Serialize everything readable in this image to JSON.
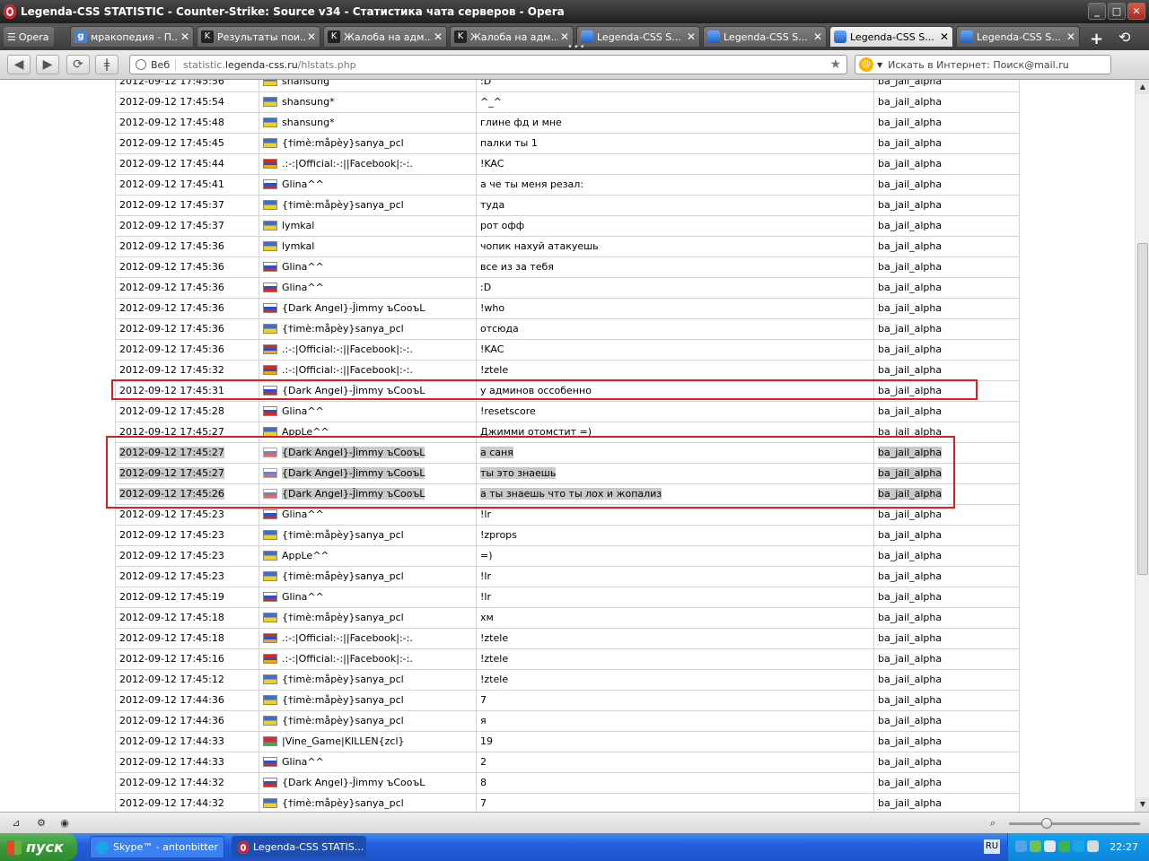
{
  "window": {
    "title": "Legenda-CSS STATISTIC - Counter-Strike: Source v34 - Статистика чата серверов - Opera",
    "minimize": "_",
    "maximize": "□",
    "close": "✕"
  },
  "tabbar": {
    "menu_label": "Opera",
    "tabs": [
      {
        "title": "мракопедия - П...",
        "icon": "google-icon",
        "close": "✕"
      },
      {
        "title": "Результаты пои...",
        "icon": "cs-icon",
        "close": "✕"
      },
      {
        "title": "Жалоба на адм...",
        "icon": "cs-icon",
        "close": "✕"
      },
      {
        "title": "Жалоба на адм...",
        "icon": "cs-icon",
        "close": "✕"
      },
      {
        "title": "Legenda-CSS S...",
        "icon": "site-icon",
        "close": "✕"
      },
      {
        "title": "Legenda-CSS S...",
        "icon": "site-icon",
        "close": "✕"
      },
      {
        "title": "Legenda-CSS S...",
        "icon": "site-icon",
        "close": "✕",
        "active": true
      },
      {
        "title": "Legenda-CSS S...",
        "icon": "site-icon",
        "close": "✕"
      }
    ],
    "dots": "•••",
    "newtab": "+",
    "history": "⟲"
  },
  "addressbar": {
    "web_label": "Веб",
    "url_prefix": "statistic.",
    "url_domain": "legenda-css.ru",
    "url_path": "/hlstats.php",
    "search_placeholder": "Искать в Интернет: Поиск@mail.ru"
  },
  "chat_rows": [
    {
      "time": "2012-09-12 17:45:56",
      "flag": "ua",
      "player": "shansung",
      "message": ":D",
      "map": "ba_jail_alpha"
    },
    {
      "time": "2012-09-12 17:45:54",
      "flag": "ua",
      "player": "shansung*",
      "message": "^_^",
      "map": "ba_jail_alpha"
    },
    {
      "time": "2012-09-12 17:45:48",
      "flag": "ua",
      "player": "shansung*",
      "message": "глине фд и мне",
      "map": "ba_jail_alpha"
    },
    {
      "time": "2012-09-12 17:45:45",
      "flag": "ua",
      "player": "{†imè:måpèy}sanya_pcl",
      "message": "палки ты 1",
      "map": "ba_jail_alpha"
    },
    {
      "time": "2012-09-12 17:45:44",
      "flag": "am",
      "player": ".:-:|Official:-:||Facebook|:-:.",
      "message": "!KAC",
      "map": "ba_jail_alpha"
    },
    {
      "time": "2012-09-12 17:45:41",
      "flag": "ru",
      "player": "Glina^^",
      "message": "а че ты меня резал:",
      "map": "ba_jail_alpha"
    },
    {
      "time": "2012-09-12 17:45:37",
      "flag": "ua",
      "player": "{†imè:måpèy}sanya_pcl",
      "message": "туда",
      "map": "ba_jail_alpha"
    },
    {
      "time": "2012-09-12 17:45:37",
      "flag": "ua",
      "player": "lymkal",
      "message": "рот офф",
      "map": "ba_jail_alpha"
    },
    {
      "time": "2012-09-12 17:45:36",
      "flag": "ua",
      "player": "lymkal",
      "message": "чопик нахуй атакуешь",
      "map": "ba_jail_alpha"
    },
    {
      "time": "2012-09-12 17:45:36",
      "flag": "ru",
      "player": "Glina^^",
      "message": "все из за тебя",
      "map": "ba_jail_alpha"
    },
    {
      "time": "2012-09-12 17:45:36",
      "flag": "ru",
      "player": "Glina^^",
      "message": ":D",
      "map": "ba_jail_alpha"
    },
    {
      "time": "2012-09-12 17:45:36",
      "flag": "ru",
      "player": "{Dark Angel}-Ĵimmy ъCooъL",
      "message": "!who",
      "map": "ba_jail_alpha"
    },
    {
      "time": "2012-09-12 17:45:36",
      "flag": "ua",
      "player": "{†imè:måpèy}sanya_pcl",
      "message": "отсюда",
      "map": "ba_jail_alpha"
    },
    {
      "time": "2012-09-12 17:45:36",
      "flag": "am",
      "player": ".:-:|Official:-:||Facebook|:-:.",
      "message": "!KAC",
      "map": "ba_jail_alpha"
    },
    {
      "time": "2012-09-12 17:45:32",
      "flag": "am",
      "player": ".:-:|Official:-:||Facebook|:-:.",
      "message": "!ztele",
      "map": "ba_jail_alpha"
    },
    {
      "time": "2012-09-12 17:45:31",
      "flag": "ru",
      "player": "{Dark Angel}-Ĵimmy ъCooъL",
      "message": "у админов оссобенно",
      "map": "ba_jail_alpha"
    },
    {
      "time": "2012-09-12 17:45:28",
      "flag": "ru",
      "player": "Glina^^",
      "message": "!resetscore",
      "map": "ba_jail_alpha"
    },
    {
      "time": "2012-09-12 17:45:27",
      "flag": "ua",
      "player": "AppLe^^",
      "message": "Джимми отомстит =)",
      "map": "ba_jail_alpha"
    },
    {
      "time": "2012-09-12 17:45:27",
      "flag": "ru",
      "player": "{Dark Angel}-Ĵimmy ъCooъL",
      "message": "а саня",
      "map": "ba_jail_alpha",
      "selected": true
    },
    {
      "time": "2012-09-12 17:45:27",
      "flag": "ru",
      "player": "{Dark Angel}-Ĵimmy ъCooъL",
      "message": "ты это знаешь",
      "map": "ba_jail_alpha",
      "selected": true
    },
    {
      "time": "2012-09-12 17:45:26",
      "flag": "ru",
      "player": "{Dark Angel}-Ĵimmy ъCooъL",
      "message": "а ты знаешь что ты лох и жопализ",
      "map": "ba_jail_alpha",
      "selected": true
    },
    {
      "time": "2012-09-12 17:45:23",
      "flag": "ru",
      "player": "Glina^^",
      "message": "!lr",
      "map": "ba_jail_alpha"
    },
    {
      "time": "2012-09-12 17:45:23",
      "flag": "ua",
      "player": "{†imè:måpèy}sanya_pcl",
      "message": "!zprops",
      "map": "ba_jail_alpha"
    },
    {
      "time": "2012-09-12 17:45:23",
      "flag": "ua",
      "player": "AppLe^^",
      "message": "=)",
      "map": "ba_jail_alpha"
    },
    {
      "time": "2012-09-12 17:45:23",
      "flag": "ua",
      "player": "{†imè:måpèy}sanya_pcl",
      "message": "!lr",
      "map": "ba_jail_alpha"
    },
    {
      "time": "2012-09-12 17:45:19",
      "flag": "ru",
      "player": "Glina^^",
      "message": "!lr",
      "map": "ba_jail_alpha"
    },
    {
      "time": "2012-09-12 17:45:18",
      "flag": "ua",
      "player": "{†imè:måpèy}sanya_pcl",
      "message": "хм",
      "map": "ba_jail_alpha"
    },
    {
      "time": "2012-09-12 17:45:18",
      "flag": "am",
      "player": ".:-:|Official:-:||Facebook|:-:.",
      "message": "!ztele",
      "map": "ba_jail_alpha"
    },
    {
      "time": "2012-09-12 17:45:16",
      "flag": "am",
      "player": ".:-:|Official:-:||Facebook|:-:.",
      "message": "!ztele",
      "map": "ba_jail_alpha"
    },
    {
      "time": "2012-09-12 17:45:12",
      "flag": "ua",
      "player": "{†imè:måpèy}sanya_pcl",
      "message": "!ztele",
      "map": "ba_jail_alpha"
    },
    {
      "time": "2012-09-12 17:44:36",
      "flag": "ua",
      "player": "{†imè:måpèy}sanya_pcl",
      "message": "7",
      "map": "ba_jail_alpha"
    },
    {
      "time": "2012-09-12 17:44:36",
      "flag": "ua",
      "player": "{†imè:måpèy}sanya_pcl",
      "message": "я",
      "map": "ba_jail_alpha"
    },
    {
      "time": "2012-09-12 17:44:33",
      "flag": "by",
      "player": "|Vine_Game|KILLEN{zcl}",
      "message": "19",
      "map": "ba_jail_alpha"
    },
    {
      "time": "2012-09-12 17:44:33",
      "flag": "ru",
      "player": "Glina^^",
      "message": "2",
      "map": "ba_jail_alpha"
    },
    {
      "time": "2012-09-12 17:44:32",
      "flag": "ru",
      "player": "{Dark Angel}-Ĵimmy ъCooъL",
      "message": "8",
      "map": "ba_jail_alpha"
    },
    {
      "time": "2012-09-12 17:44:32",
      "flag": "ua",
      "player": "{†imè:måpèy}sanya_pcl",
      "message": "7",
      "map": "ba_jail_alpha"
    }
  ],
  "taskbar": {
    "start_label": "пуск",
    "tasks": [
      {
        "label": "Skype™ - antonbitter"
      },
      {
        "label": "Legenda-CSS STATIS..."
      }
    ],
    "lang": "RU",
    "clock": "22:27"
  },
  "colors": {
    "highlight_box": "#e01c1c",
    "selection": "#c9c9c9"
  }
}
